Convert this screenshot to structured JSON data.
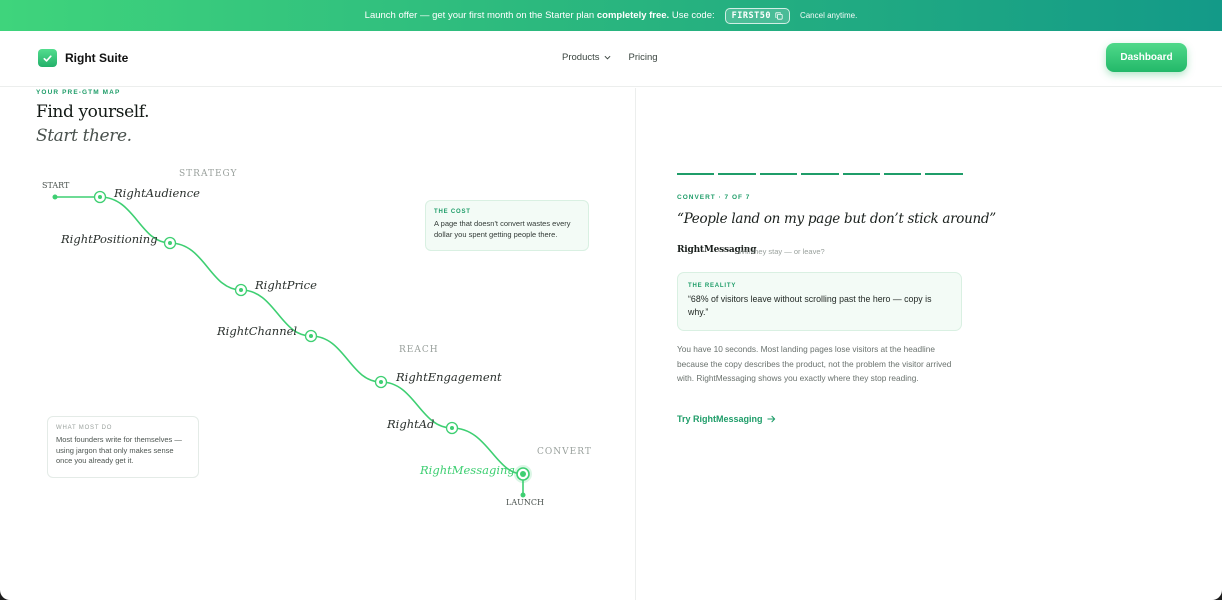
{
  "banner": {
    "text_before": "Launch offer — get your first month on the Starter plan",
    "text_bold": "completely free.",
    "code_prefix": "Use code:",
    "code": "FIRST50",
    "copy_icon": "copy-icon",
    "cancel_note": "Cancel anytime."
  },
  "header": {
    "brand": "Right Suite",
    "logo_icon": "check-icon",
    "nav": [
      {
        "label": "Products",
        "icon": "chevron-down-icon"
      },
      {
        "label": "Pricing"
      }
    ],
    "dashboard_label": "Dashboard"
  },
  "left": {
    "eyebrow": "YOUR PRE-GTM MAP",
    "hero_line1": "Find yourself.",
    "hero_line2": "Start there.",
    "map": {
      "start_label": "START",
      "launch_label": "LAUNCH",
      "stages": [
        "STRATEGY",
        "REACH",
        "CONVERT"
      ],
      "steps": [
        {
          "label": "RightAudience",
          "active": false
        },
        {
          "label": "RightPositioning",
          "active": false
        },
        {
          "label": "RightPrice",
          "active": false
        },
        {
          "label": "RightChannel",
          "active": false
        },
        {
          "label": "RightEngagement",
          "active": false
        },
        {
          "label": "RightAd",
          "active": false
        },
        {
          "label": "RightMessaging",
          "active": true
        }
      ]
    },
    "cost_card": {
      "eyebrow": "THE COST",
      "body": "A page that doesn't convert wastes every dollar you spent getting people there."
    },
    "most_card": {
      "eyebrow": "WHAT MOST DO",
      "body": "Most founders write for themselves — using jargon that only makes sense once you already get it."
    }
  },
  "right": {
    "progress": {
      "current": 7,
      "total": 7
    },
    "step_eyebrow": "CONVERT · 7 OF 7",
    "quote": "“People land on my page but don’t stick around”",
    "product_name": "RightMessaging",
    "product_tag": "Will they stay — or leave?",
    "reality": {
      "eyebrow": "THE REALITY",
      "body": "“68% of visitors leave without scrolling past the hero — copy is why.”"
    },
    "description": "You have 10 seconds. Most landing pages lose visitors at the headline because the copy describes the product, not the problem the visitor arrived with. RightMessaging shows you exactly where they stop reading.",
    "cta_label": "Try RightMessaging",
    "cta_icon": "arrow-right-icon"
  },
  "colors": {
    "accent": "#1f9d69",
    "path_green": "#3ecf72",
    "banner_start": "#3fd47c",
    "banner_end": "#139a88"
  }
}
